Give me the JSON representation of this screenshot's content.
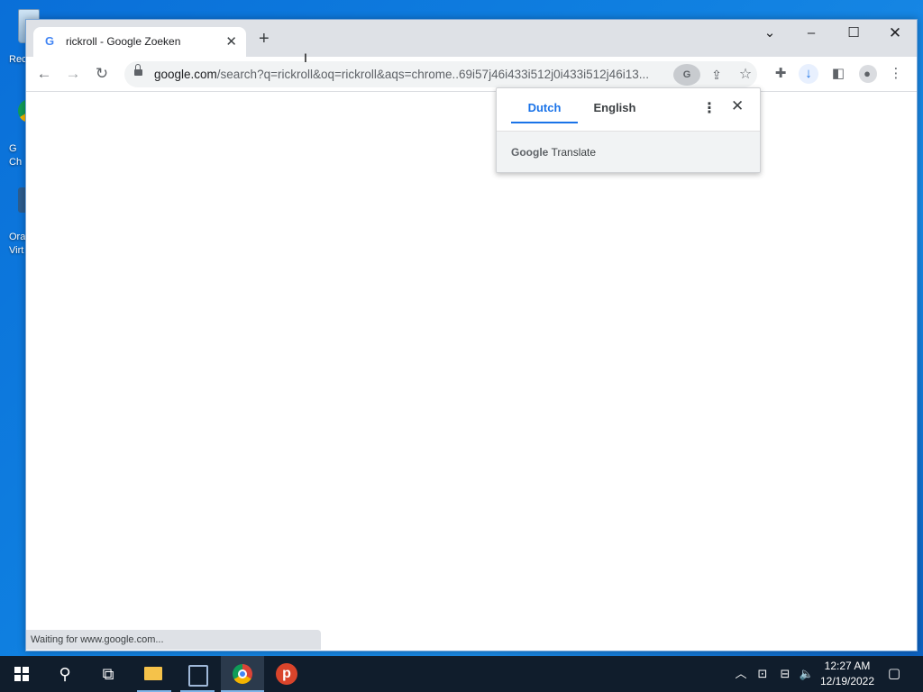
{
  "desktop": {
    "icons": [
      {
        "label": "Rec"
      },
      {
        "label": "G\nCh"
      },
      {
        "label": "Ora\nVirt"
      }
    ]
  },
  "browser": {
    "tab": {
      "favicon": "G",
      "title": "rickroll - Google Zoeken"
    },
    "window_controls": {
      "tab_search": "⌄",
      "minimize": "–",
      "maximize": "☐",
      "close": "✕"
    },
    "address": {
      "host": "google.com",
      "path": "/search?q=rickroll&oq=rickroll&aqs=chrome..69i57j46i433i512j0i433i512j46i13..."
    },
    "status_text": "Waiting for www.google.com..."
  },
  "translate_bubble": {
    "languages": [
      "Dutch",
      "English"
    ],
    "selected": "Dutch",
    "brand_google": "Google",
    "brand_product": "Translate"
  },
  "taskbar": {
    "clock_time": "12:27 AM",
    "clock_date": "12/19/2022",
    "psiphon_letter": "p"
  },
  "colors": {
    "accent": "#1a73e8",
    "taskbar": "#101d2c",
    "desktop": "#0f7fe0"
  }
}
